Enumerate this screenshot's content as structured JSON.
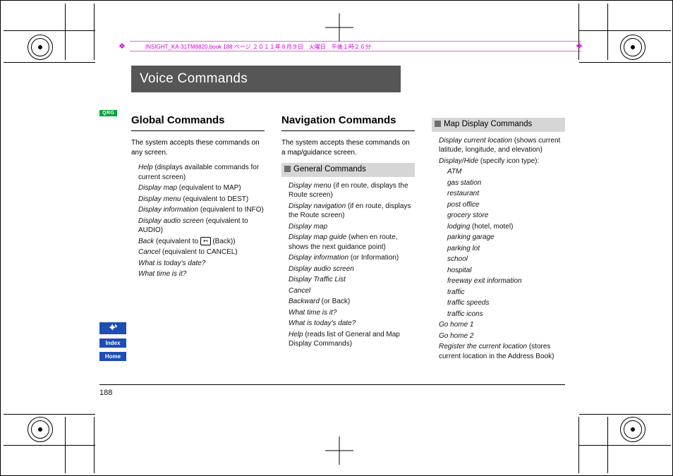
{
  "running_head": "INSIGHT_KA-31TM8820.book  188 ページ  ２０１１年８月９日　火曜日　午後１時２６分",
  "title": "Voice Commands",
  "qrg_label": "QRG",
  "sidetabs": {
    "voice_glyph": "✦ᔉ",
    "index": "Index",
    "home": "Home"
  },
  "page_number": "188",
  "global": {
    "heading": "Global Commands",
    "intro": "The system accepts these commands on any screen.",
    "items": [
      {
        "cmd": "Help",
        "note": " (displays available commands for current screen)"
      },
      {
        "cmd": "Display map",
        "note": " (equivalent to MAP)"
      },
      {
        "cmd": "Display menu",
        "note": " (equivalent to DEST)"
      },
      {
        "cmd": "Display information",
        "note": " (equivalent to INFO)"
      },
      {
        "cmd": "Display audio screen",
        "note": " (equivalent to AUDIO)"
      },
      {
        "cmd": "Back",
        "note_pre": " (equivalent to ",
        "icon": "↤",
        "note_post": " (Back))"
      },
      {
        "cmd": "Cancel",
        "note": " (equivalent to CANCEL)"
      },
      {
        "cmd": "What is today's date?",
        "note": ""
      },
      {
        "cmd": "What time is it?",
        "note": ""
      }
    ]
  },
  "navigation": {
    "heading": "Navigation Commands",
    "intro": "The system accepts these commands on a map/guidance screen.",
    "general": {
      "subhead": "General Commands",
      "items": [
        {
          "cmd": "Display menu",
          "note": " (if en route, displays the Route screen)"
        },
        {
          "cmd": "Display navigation",
          "note": " (if en route, displays the Route screen)"
        },
        {
          "cmd": "Display map",
          "note": ""
        },
        {
          "cmd": "Display map guide",
          "note": " (when en route, shows the next guidance point)"
        },
        {
          "cmd": "Display information",
          "note": " (or Information)"
        },
        {
          "cmd": "Display audio screen",
          "note": ""
        },
        {
          "cmd": "Display Traffic List",
          "note": ""
        },
        {
          "cmd": "Cancel",
          "note": ""
        },
        {
          "cmd": "Backward",
          "note": " (or Back)"
        },
        {
          "cmd": "What time is it?",
          "note": ""
        },
        {
          "cmd": "What is today's date?",
          "note": ""
        },
        {
          "cmd": "Help",
          "note": " (reads list of General and Map Display Commands)"
        }
      ]
    }
  },
  "mapdisplay": {
    "subhead": "Map Display Commands",
    "lead1": {
      "cmd": "Display current location",
      "note": " (shows current latitude, longitude, and elevation)"
    },
    "lead2": {
      "cmd": "Display/Hide",
      "note": " (specify icon type):"
    },
    "icon_types": [
      "ATM",
      "gas station",
      "restaurant",
      "post office",
      "grocery store",
      {
        "cmd": "lodging",
        "note": " (hotel, motel)"
      },
      "parking garage",
      "parking lot",
      "school",
      "hospital",
      "freeway exit information",
      "traffic",
      "traffic speeds",
      "traffic icons"
    ],
    "tail": [
      {
        "cmd": "Go home 1",
        "note": ""
      },
      {
        "cmd": "Go home 2",
        "note": ""
      },
      {
        "cmd": "Register the current location",
        "note": " (stores current location in the Address Book)"
      }
    ]
  }
}
